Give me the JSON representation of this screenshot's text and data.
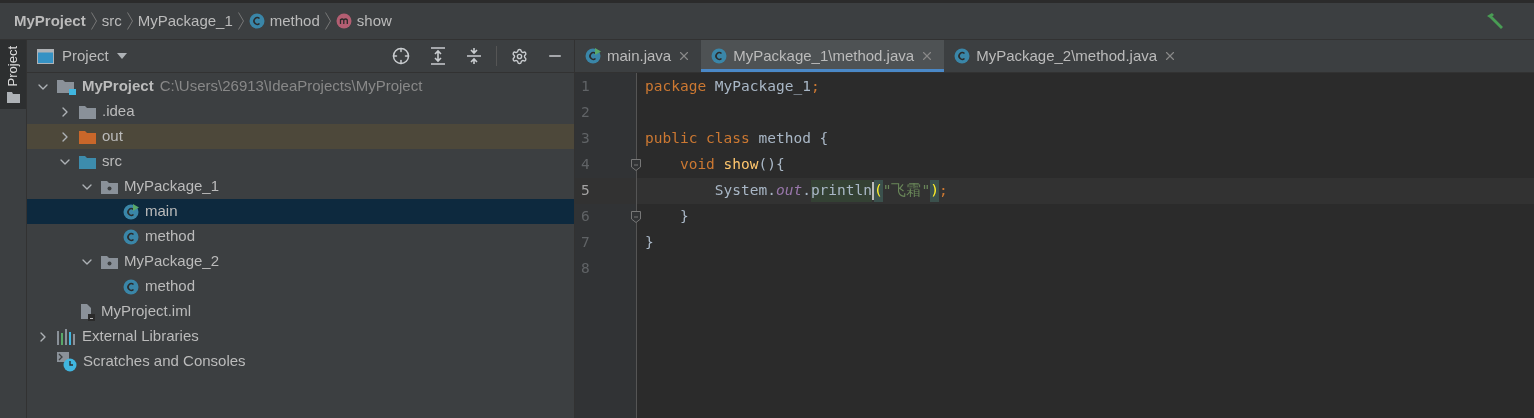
{
  "breadcrumb": [
    {
      "label": "MyProject",
      "kind": "project"
    },
    {
      "label": "src",
      "kind": "plain"
    },
    {
      "label": "MyPackage_1",
      "kind": "plain"
    },
    {
      "label": "method",
      "kind": "class"
    },
    {
      "label": "show",
      "kind": "method"
    }
  ],
  "side_strip": {
    "label": "Project",
    "selected": true
  },
  "project_panel": {
    "title": "Project",
    "tree": [
      {
        "label": "MyProject",
        "kind": "project",
        "path": "C:\\Users\\26913\\IdeaProjects\\MyProject",
        "expanded": true,
        "selected": false,
        "excluded": false,
        "children": [
          {
            "label": ".idea",
            "kind": "folder",
            "color": "#8a9199",
            "expanded": false,
            "selected": false,
            "excluded": false
          },
          {
            "label": "out",
            "kind": "folder",
            "color": "#c9672a",
            "expanded": false,
            "selected": false,
            "excluded": true
          },
          {
            "label": "src",
            "kind": "folder",
            "color": "#3d8cad",
            "expanded": true,
            "selected": false,
            "excluded": false,
            "children": [
              {
                "label": "MyPackage_1",
                "kind": "package",
                "expanded": true,
                "selected": false,
                "excluded": false,
                "children": [
                  {
                    "label": "main",
                    "kind": "class",
                    "runnable": true,
                    "selected": true,
                    "excluded": false
                  },
                  {
                    "label": "method",
                    "kind": "class",
                    "runnable": false,
                    "selected": false,
                    "excluded": false
                  }
                ]
              },
              {
                "label": "MyPackage_2",
                "kind": "package",
                "expanded": true,
                "selected": false,
                "excluded": false,
                "children": [
                  {
                    "label": "method",
                    "kind": "class",
                    "runnable": false,
                    "selected": false,
                    "excluded": false
                  }
                ]
              }
            ]
          },
          {
            "label": "MyProject.iml",
            "kind": "file",
            "selected": false,
            "excluded": false
          }
        ]
      },
      {
        "label": "External Libraries",
        "kind": "libraries",
        "expanded": false,
        "selected": false,
        "excluded": false
      },
      {
        "label": "Scratches and Consoles",
        "kind": "scratches",
        "selected": false,
        "excluded": false
      }
    ]
  },
  "tabs": [
    {
      "label": "main.java",
      "runnable": true,
      "selected": false
    },
    {
      "label": "MyPackage_1\\method.java",
      "runnable": false,
      "selected": true
    },
    {
      "label": "MyPackage_2\\method.java",
      "runnable": false,
      "selected": false
    }
  ],
  "editor": {
    "lines": [
      {
        "number": "1",
        "current": false,
        "fold": false,
        "tokens": [
          {
            "text": "package ",
            "kind": "kw"
          },
          {
            "text": "MyPackage_1",
            "kind": "text"
          },
          {
            "text": ";",
            "kind": "kw"
          }
        ]
      },
      {
        "number": "2",
        "current": false,
        "fold": false
      },
      {
        "number": "3",
        "current": false,
        "fold": false,
        "tokens": [
          {
            "text": "public class ",
            "kind": "kw"
          },
          {
            "text": "method {",
            "kind": "text"
          }
        ]
      },
      {
        "number": "4",
        "current": false,
        "fold": true,
        "tokens": [
          {
            "text": "    void ",
            "kind": "kw"
          },
          {
            "text": "show",
            "kind": "fn"
          },
          {
            "text": "(){",
            "kind": "text"
          }
        ]
      },
      {
        "number": "5",
        "current": true,
        "fold": false,
        "tokens": [
          {
            "text": "        System.",
            "kind": "text"
          },
          {
            "text": "out",
            "kind": "field"
          },
          {
            "text": ".",
            "kind": "text"
          },
          {
            "text": "println",
            "kind": "usage",
            "caret_after": true
          },
          {
            "text": "(",
            "kind": "brace"
          },
          {
            "text": "\"飞霜\"",
            "kind": "str"
          },
          {
            "text": ")",
            "kind": "brace"
          },
          {
            "text": ";",
            "kind": "kw"
          }
        ]
      },
      {
        "number": "6",
        "current": false,
        "fold": true,
        "tokens": [
          {
            "text": "    }",
            "kind": "text"
          }
        ]
      },
      {
        "number": "7",
        "current": false,
        "fold": false,
        "tokens": [
          {
            "text": "}",
            "kind": "text"
          }
        ]
      },
      {
        "number": "8",
        "current": false,
        "fold": false
      }
    ]
  }
}
